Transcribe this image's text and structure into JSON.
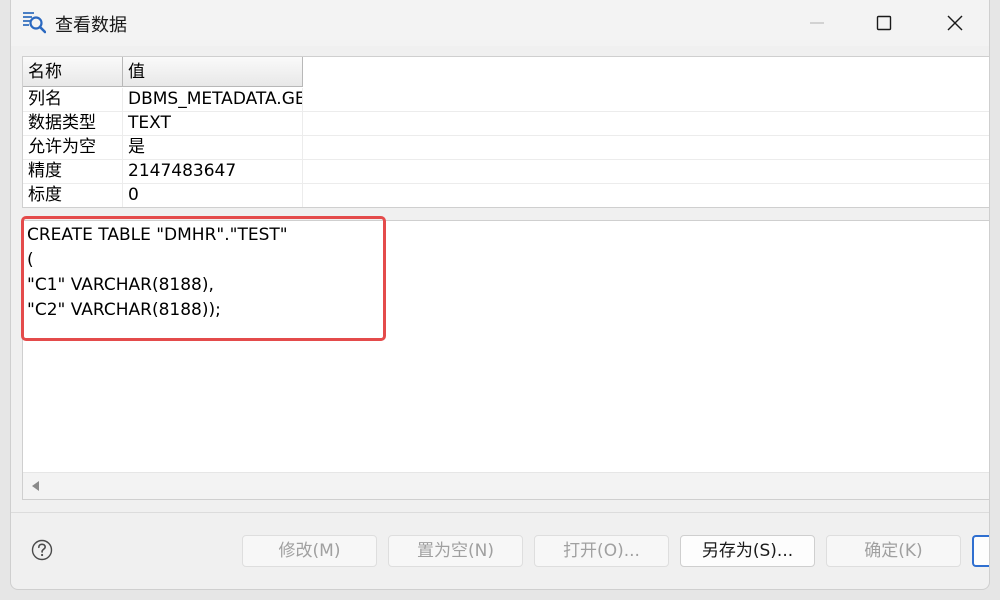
{
  "window": {
    "title": "查看数据"
  },
  "properties": {
    "headers": {
      "name": "名称",
      "value": "值"
    },
    "rows": [
      {
        "name": "列名",
        "value": "DBMS_METADATA.GET_DDL"
      },
      {
        "name": "数据类型",
        "value": "TEXT"
      },
      {
        "name": "允许为空",
        "value": "是"
      },
      {
        "name": "精度",
        "value": "2147483647"
      },
      {
        "name": "标度",
        "value": "0"
      }
    ]
  },
  "content": {
    "text": "CREATE TABLE \"DMHR\".\"TEST\"\n(\n\"C1\" VARCHAR(8188),\n\"C2\" VARCHAR(8188));"
  },
  "buttons": {
    "modify": "修改(M)",
    "set_null": "置为空(N)",
    "open": "打开(O)...",
    "save_as": "另存为(S)...",
    "ok": "确定(K)"
  },
  "colors": {
    "highlight": "#e44b4b",
    "accent": "#2f6fd0"
  }
}
